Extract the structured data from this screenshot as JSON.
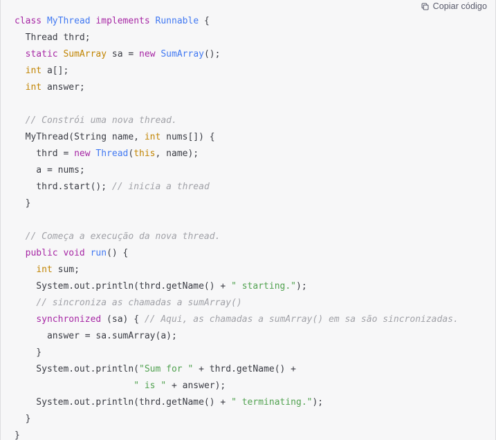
{
  "toolbar": {
    "copy_label": "Copiar código",
    "copy_icon": "copy-icon"
  },
  "colors": {
    "background": "#f7f7f8",
    "border": "#dcdce0",
    "plain": "#383a42",
    "keyword": "#a626a4",
    "type": "#4078f2",
    "builtin": "#c18401",
    "string": "#50a14f",
    "comment": "#a0a1a7",
    "button_text": "#565869"
  },
  "code": {
    "language": "java",
    "lines": [
      [
        {
          "t": "class",
          "c": "kw"
        },
        {
          "t": " ",
          "c": "pl"
        },
        {
          "t": "MyThread",
          "c": "typ"
        },
        {
          "t": " ",
          "c": "pl"
        },
        {
          "t": "implements",
          "c": "kw"
        },
        {
          "t": " ",
          "c": "pl"
        },
        {
          "t": "Runnable",
          "c": "typ"
        },
        {
          "t": " {",
          "c": "pl"
        }
      ],
      [
        {
          "t": "  Thread thrd;",
          "c": "pl"
        }
      ],
      [
        {
          "t": "  ",
          "c": "pl"
        },
        {
          "t": "static",
          "c": "kw"
        },
        {
          "t": " ",
          "c": "pl"
        },
        {
          "t": "SumArray",
          "c": "bi"
        },
        {
          "t": " sa = ",
          "c": "pl"
        },
        {
          "t": "new",
          "c": "kw"
        },
        {
          "t": " ",
          "c": "pl"
        },
        {
          "t": "SumArray",
          "c": "typ"
        },
        {
          "t": "();",
          "c": "pl"
        }
      ],
      [
        {
          "t": "  ",
          "c": "pl"
        },
        {
          "t": "int",
          "c": "bi"
        },
        {
          "t": " a[];",
          "c": "pl"
        }
      ],
      [
        {
          "t": "  ",
          "c": "pl"
        },
        {
          "t": "int",
          "c": "bi"
        },
        {
          "t": " answer;",
          "c": "pl"
        }
      ],
      [],
      [
        {
          "t": "  ",
          "c": "pl"
        },
        {
          "t": "// Constrói uma nova thread.",
          "c": "cmt"
        }
      ],
      [
        {
          "t": "  MyThread(String name, ",
          "c": "pl"
        },
        {
          "t": "int",
          "c": "bi"
        },
        {
          "t": " nums[]) {",
          "c": "pl"
        }
      ],
      [
        {
          "t": "    thrd = ",
          "c": "pl"
        },
        {
          "t": "new",
          "c": "kw"
        },
        {
          "t": " ",
          "c": "pl"
        },
        {
          "t": "Thread",
          "c": "typ"
        },
        {
          "t": "(",
          "c": "pl"
        },
        {
          "t": "this",
          "c": "bi"
        },
        {
          "t": ", name);",
          "c": "pl"
        }
      ],
      [
        {
          "t": "    a = nums;",
          "c": "pl"
        }
      ],
      [
        {
          "t": "    thrd.start(); ",
          "c": "pl"
        },
        {
          "t": "// inicia a thread",
          "c": "cmt"
        }
      ],
      [
        {
          "t": "  }",
          "c": "pl"
        }
      ],
      [],
      [
        {
          "t": "  ",
          "c": "pl"
        },
        {
          "t": "// Começa a execução da nova thread.",
          "c": "cmt"
        }
      ],
      [
        {
          "t": "  ",
          "c": "pl"
        },
        {
          "t": "public",
          "c": "kw"
        },
        {
          "t": " ",
          "c": "pl"
        },
        {
          "t": "void",
          "c": "kw"
        },
        {
          "t": " ",
          "c": "pl"
        },
        {
          "t": "run",
          "c": "typ"
        },
        {
          "t": "() {",
          "c": "pl"
        }
      ],
      [
        {
          "t": "    ",
          "c": "pl"
        },
        {
          "t": "int",
          "c": "bi"
        },
        {
          "t": " sum;",
          "c": "pl"
        }
      ],
      [
        {
          "t": "    System.out.println(thrd.getName() + ",
          "c": "pl"
        },
        {
          "t": "\" starting.\"",
          "c": "str"
        },
        {
          "t": ");",
          "c": "pl"
        }
      ],
      [
        {
          "t": "    ",
          "c": "pl"
        },
        {
          "t": "// sincroniza as chamadas a sumArray()",
          "c": "cmt"
        }
      ],
      [
        {
          "t": "    ",
          "c": "pl"
        },
        {
          "t": "synchronized",
          "c": "kw"
        },
        {
          "t": " (sa) { ",
          "c": "pl"
        },
        {
          "t": "// Aqui, as chamadas a sumArray() em sa são sincronizadas.",
          "c": "cmt"
        }
      ],
      [
        {
          "t": "      answer = sa.sumArray(a);",
          "c": "pl"
        }
      ],
      [
        {
          "t": "    }",
          "c": "pl"
        }
      ],
      [
        {
          "t": "    System.out.println(",
          "c": "pl"
        },
        {
          "t": "\"Sum for \"",
          "c": "str"
        },
        {
          "t": " + thrd.getName() +",
          "c": "pl"
        }
      ],
      [
        {
          "t": "                      ",
          "c": "pl"
        },
        {
          "t": "\" is \"",
          "c": "str"
        },
        {
          "t": " + answer);",
          "c": "pl"
        }
      ],
      [
        {
          "t": "    System.out.println(thrd.getName() + ",
          "c": "pl"
        },
        {
          "t": "\" terminating.\"",
          "c": "str"
        },
        {
          "t": ");",
          "c": "pl"
        }
      ],
      [
        {
          "t": "  }",
          "c": "pl"
        }
      ],
      [
        {
          "t": "}",
          "c": "pl"
        }
      ]
    ]
  }
}
